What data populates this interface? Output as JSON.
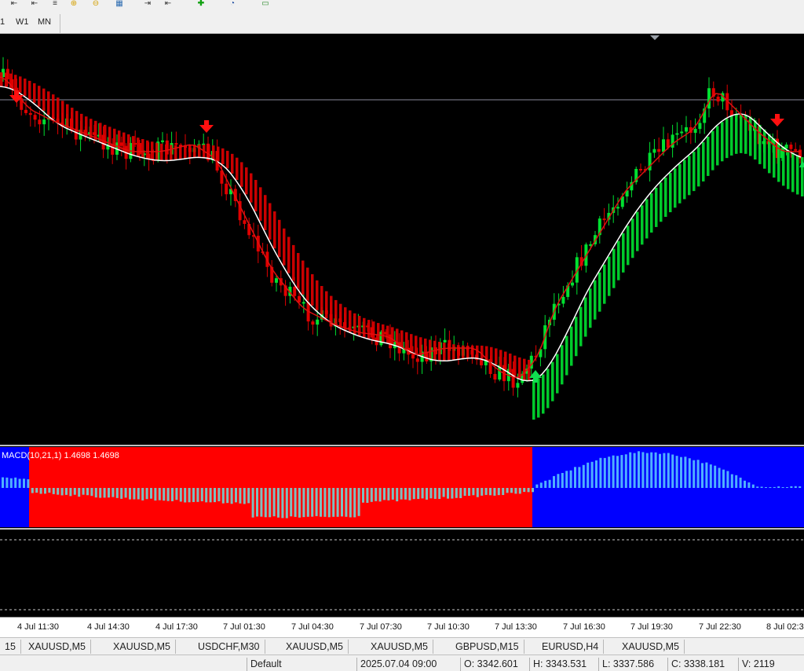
{
  "timeframes": [
    "1",
    "W1",
    "MN"
  ],
  "macd": {
    "label": "MACD(10,21,1) 1.4698 1.4698"
  },
  "time_axis": [
    "4 Jul 11:30",
    "4 Jul 14:30",
    "4 Jul 17:30",
    "7 Jul 01:30",
    "7 Jul 04:30",
    "7 Jul 07:30",
    "7 Jul 10:30",
    "7 Jul 13:30",
    "7 Jul 16:30",
    "7 Jul 19:30",
    "7 Jul 22:30",
    "8 Jul 02:3"
  ],
  "tabs": [
    "15",
    "XAUUSD,M5",
    "XAUUSD,M5",
    "USDCHF,M30",
    "XAUUSD,M5",
    "XAUUSD,M5",
    "GBPUSD,M15",
    "EURUSD,H4",
    "XAUUSD,M5"
  ],
  "status": {
    "profile": "Default",
    "datetime": "2025.07.04 09:00",
    "open": "O: 3342.601",
    "high": "H: 3343.531",
    "low": "L: 3337.586",
    "close": "C: 3338.181",
    "volume": "V: 2119"
  },
  "colors": {
    "bull": "#00e030",
    "bear": "#e00000",
    "ma_fast": "#e01010",
    "ma_slow": "#ffffff",
    "macd_bear_bg": "#ff0000",
    "macd_bull_bg": "#0000ff",
    "macd_hist_bear": "#7fbfbf",
    "macd_hist_bull": "#4fb0ff"
  },
  "icons": [
    "move-left-icon",
    "move-right-icon",
    "align-icon",
    "zoom-in-icon",
    "zoom-out-icon",
    "grid-icon",
    "scroll-left-icon",
    "scroll-right-icon",
    "add-indicator-icon",
    "clock-icon",
    "chart-image-icon"
  ]
}
